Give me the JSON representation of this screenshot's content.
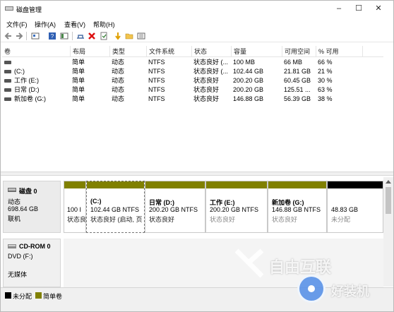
{
  "window": {
    "title": "磁盘管理",
    "minimize": "–",
    "maximize": "☐",
    "close": "✕"
  },
  "menu": [
    "文件(F)",
    "操作(A)",
    "查看(V)",
    "帮助(H)"
  ],
  "toolbar_icons": [
    "back-icon",
    "forward-icon",
    "properties-icon",
    "help-icon",
    "view-icon",
    "connect-icon",
    "delete-icon",
    "check-icon",
    "refresh-icon",
    "folder-icon",
    "list-icon"
  ],
  "columns": [
    "卷",
    "布局",
    "类型",
    "文件系统",
    "状态",
    "容量",
    "可用空间",
    "% 可用"
  ],
  "volumes": [
    {
      "name": "",
      "layout": "简单",
      "type": "动态",
      "fs": "NTFS",
      "status": "状态良好 (...",
      "capacity": "100 MB",
      "free": "66 MB",
      "pct": "66 %"
    },
    {
      "name": "(C:)",
      "layout": "简单",
      "type": "动态",
      "fs": "NTFS",
      "status": "状态良好 (...",
      "capacity": "102.44 GB",
      "free": "21.81 GB",
      "pct": "21 %"
    },
    {
      "name": "工作 (E:)",
      "layout": "简单",
      "type": "动态",
      "fs": "NTFS",
      "status": "状态良好",
      "capacity": "200.20 GB",
      "free": "60.45 GB",
      "pct": "30 %"
    },
    {
      "name": "日常 (D:)",
      "layout": "简单",
      "type": "动态",
      "fs": "NTFS",
      "status": "状态良好",
      "capacity": "200.20 GB",
      "free": "125.51 ...",
      "pct": "63 %"
    },
    {
      "name": "新加卷 (G:)",
      "layout": "简单",
      "type": "动态",
      "fs": "NTFS",
      "status": "状态良好",
      "capacity": "146.88 GB",
      "free": "56.39 GB",
      "pct": "38 %"
    }
  ],
  "disk0": {
    "name": "磁盘 0",
    "type": "动态",
    "size": "698.64 GB",
    "state": "联机",
    "partitions": [
      {
        "name": "",
        "size": "100 I",
        "status": "状态良"
      },
      {
        "name": "(C:)",
        "size": "102.44 GB NTFS",
        "status": "状态良好 (启动, 页"
      },
      {
        "name": "日常  (D:)",
        "size": "200.20 GB NTFS",
        "status": "状态良好"
      },
      {
        "name": "工作  (E:)",
        "size": "200.20 GB NTFS",
        "status": "状态良好"
      },
      {
        "name": "新加卷  (G:)",
        "size": "146.88 GB NTFS",
        "status": "状态良好"
      },
      {
        "name": "",
        "size": "48.83 GB",
        "status": "未分配"
      }
    ]
  },
  "cdrom": {
    "name": "CD-ROM 0",
    "drive": "DVD (F:)",
    "media": "无媒体"
  },
  "legend": [
    {
      "label": "未分配",
      "color": "#000000"
    },
    {
      "label": "简单卷",
      "color": "#808000"
    }
  ],
  "watermark": {
    "brand": "自由互联",
    "site": "好装机"
  },
  "colors": {
    "simple_volume": "#808000",
    "unallocated": "#000000"
  }
}
